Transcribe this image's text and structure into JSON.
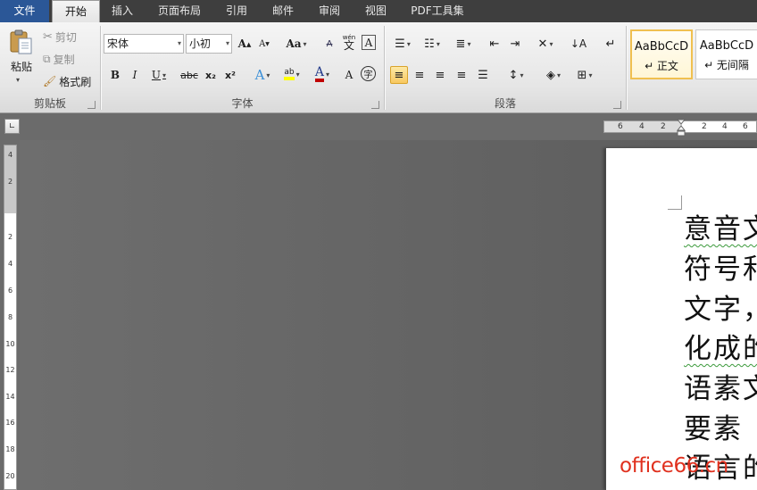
{
  "tabs": [
    {
      "label": "文件"
    },
    {
      "label": "开始"
    },
    {
      "label": "插入"
    },
    {
      "label": "页面布局"
    },
    {
      "label": "引用"
    },
    {
      "label": "邮件"
    },
    {
      "label": "审阅"
    },
    {
      "label": "视图"
    },
    {
      "label": "PDF工具集"
    }
  ],
  "clipboard": {
    "group_label": "剪贴板",
    "paste_label": "粘贴",
    "cut_label": "剪切",
    "copy_label": "复制",
    "format_painter_label": "格式刷"
  },
  "font": {
    "group_label": "字体",
    "font_name": "宋体",
    "font_size": "小初",
    "grow_font": "A",
    "shrink_font": "A",
    "change_case": "Aa",
    "bold": "B",
    "italic": "I",
    "underline": "U",
    "strikethrough": "abc",
    "subscript": "x₂",
    "superscript": "x²",
    "text_effects": "A",
    "highlight": "ab",
    "font_color": "A",
    "char_shading": "A",
    "enclose_char": "字",
    "wen_label": "wén",
    "wen_char": "文",
    "clear_format": "A"
  },
  "paragraph": {
    "group_label": "段落"
  },
  "styles": {
    "items": [
      {
        "sample": "AaBbCcD",
        "name": "↵ 正文"
      },
      {
        "sample": "AaBbCcD",
        "name": "↵ 无间隔"
      }
    ]
  },
  "ruler": {
    "horizontal_numbers": [
      "6",
      "4",
      "2",
      "2",
      "4",
      "6"
    ],
    "vertical_numbers": [
      "4",
      "2",
      "2",
      "4",
      "6",
      "8",
      "10",
      "12",
      "14",
      "16",
      "18",
      "20"
    ]
  },
  "document": {
    "lines": [
      "意音文",
      "符号和",
      "文字，",
      "化成的",
      "语素文",
      "要素",
      "语言的"
    ]
  },
  "watermark": "office66.cn",
  "colors": {
    "tabbar_bg": "#3e3e3e",
    "file_tab_bg": "#2b5797",
    "selected_style_border": "#f0c050",
    "watermark": "#e0301e",
    "font_color_bar": "#c00000",
    "highlight_bar": "#ffff00"
  }
}
